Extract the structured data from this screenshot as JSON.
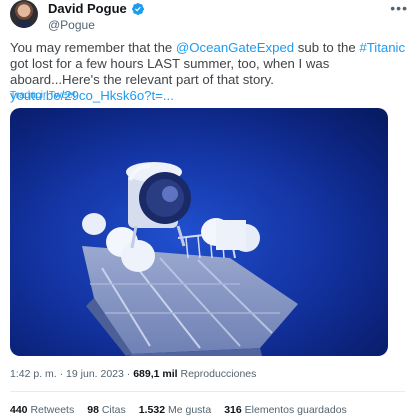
{
  "author": {
    "name": "David Pogue",
    "handle": "@Pogue",
    "verified_color": "#1d9bf0"
  },
  "tweet": {
    "text_parts": [
      {
        "text": "You may remember that the ",
        "link": false
      },
      {
        "text": "@OceanGateExped",
        "link": true
      },
      {
        "text": " sub to the ",
        "link": false
      },
      {
        "text": "#Titanic",
        "link": true
      },
      {
        "text": " got lost for a few hours LAST summer, too, when I was aboard...Here's the relevant part of that story. ",
        "link": false
      },
      {
        "text": "youtu.be/29co_Hksk6o?t=...",
        "link": true
      }
    ],
    "translate_label": "Traducir Tweet",
    "media_alt_icon": "submersible-image"
  },
  "meta": {
    "time": "1:42 p. m.",
    "separator": "·",
    "date": "19 jun. 2023",
    "views_count": "689,1 mil",
    "views_label": "Reproducciones"
  },
  "stats": [
    {
      "count": "440",
      "label": "Retweets"
    },
    {
      "count": "98",
      "label": "Citas"
    },
    {
      "count": "1.532",
      "label": "Me gusta"
    },
    {
      "count": "316",
      "label": "Elementos guardados"
    }
  ],
  "colors": {
    "link": "#1d9bf0",
    "text": "#0f1419",
    "muted": "#536471",
    "water": "#1435a8"
  }
}
